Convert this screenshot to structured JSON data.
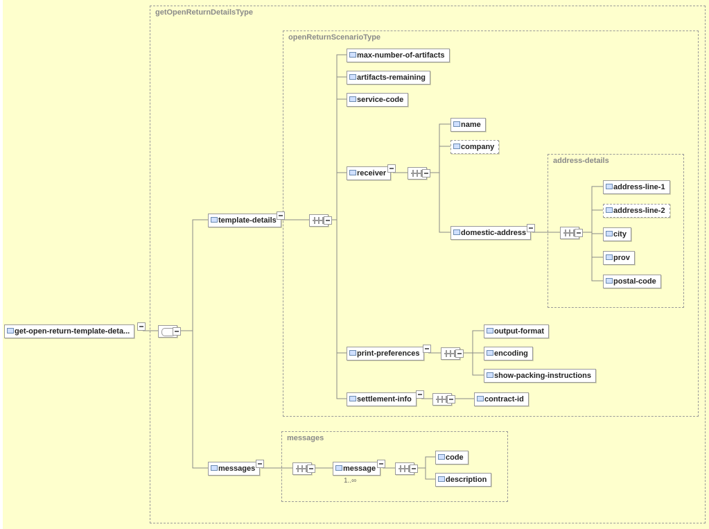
{
  "root": {
    "label": "get-open-return-template-deta..."
  },
  "groups": {
    "outer": "getOpenReturnDetailsType",
    "scenario": "openReturnScenarioType",
    "address": "address-details",
    "messages": "messages"
  },
  "template_details": {
    "label": "template-details",
    "max_artifacts": "max-number-of-artifacts",
    "artifacts_remaining": "artifacts-remaining",
    "service_code": "service-code",
    "receiver": {
      "label": "receiver",
      "name": "name",
      "company": "company",
      "domestic_address": {
        "label": "domestic-address",
        "line1": "address-line-1",
        "line2": "address-line-2",
        "city": "city",
        "prov": "prov",
        "postal": "postal-code"
      }
    },
    "print_prefs": {
      "label": "print-preferences",
      "output_format": "output-format",
      "encoding": "encoding",
      "show_packing": "show-packing-instructions"
    },
    "settlement": {
      "label": "settlement-info",
      "contract_id": "contract-id"
    }
  },
  "messages": {
    "label": "messages",
    "message": "message",
    "occurs": "1..∞",
    "code": "code",
    "description": "description"
  }
}
